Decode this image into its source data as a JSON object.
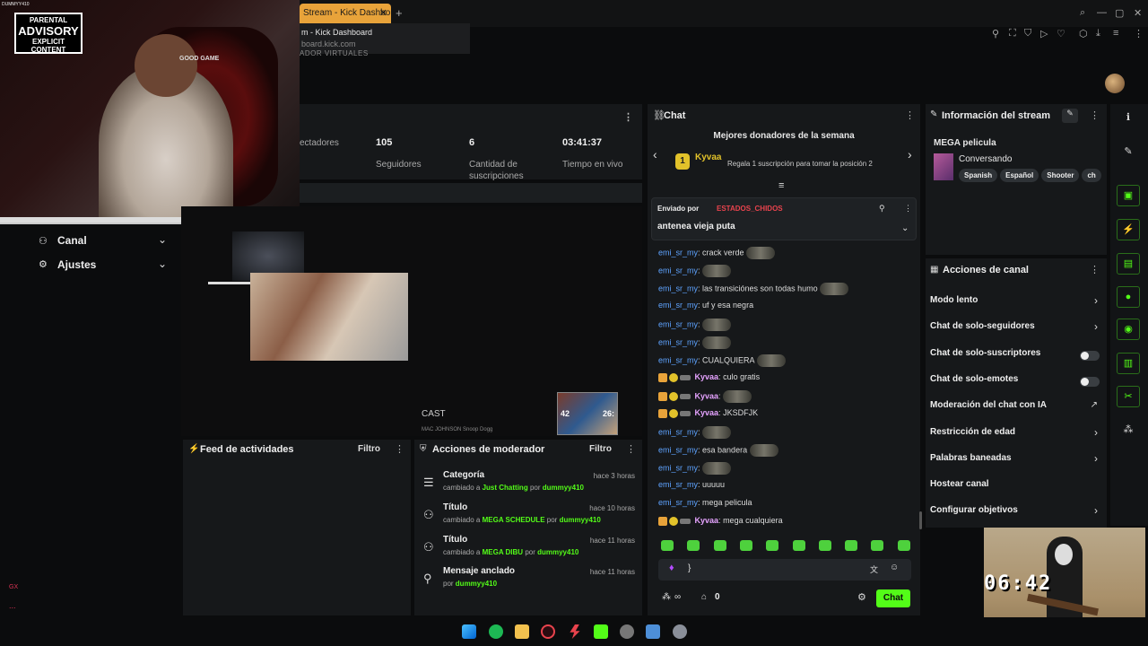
{
  "browser": {
    "tab_title": "Stream - Kick Dashbo",
    "tab_close": "✕",
    "new_tab": "+",
    "tooltip_title": "m - Kick Dashboard",
    "tooltip_url": "board.kick.com",
    "subnav": "ADOR      VIRTUALES"
  },
  "webcam": {
    "label": "DUMMYY410",
    "advisory_top": "PARENTAL",
    "advisory_mid": "ADVISORY",
    "advisory_bot": "EXPLICIT CONTENT",
    "cap_text": "GOOD GAME"
  },
  "sidebar": {
    "items": [
      {
        "label": "Canal",
        "icon": "users-icon"
      },
      {
        "label": "Ajustes",
        "icon": "gear-icon"
      }
    ],
    "gx_label": "GX",
    "more": "..."
  },
  "stats": [
    {
      "value": "",
      "label": "ectadores"
    },
    {
      "value": "105",
      "label": "Seguidores"
    },
    {
      "value": "6",
      "label": "Cantidad de suscripciones"
    },
    {
      "value": "03:41:37",
      "label": "Tiempo en vivo"
    }
  ],
  "video": {
    "cast_title": "CAST",
    "cast_sub": "MAC JOHNSON  Snoop Dogg",
    "thumb_left": "42",
    "thumb_right": "26:"
  },
  "activity": {
    "title": "Feed de actividades",
    "filter": "Filtro"
  },
  "moderator": {
    "title": "Acciones de moderador",
    "filter": "Filtro",
    "rows": [
      {
        "title": "Categoría",
        "pre": "cambiado a",
        "value": "Just Chatting",
        "by": "por",
        "user": "dummyy410",
        "time": "hace 3 horas"
      },
      {
        "title": "Título",
        "pre": "cambiado a",
        "value": "MEGA SCHEDULE",
        "by": "por",
        "user": "dummyy410",
        "time": "hace 10 horas"
      },
      {
        "title": "Título",
        "pre": "cambiado a",
        "value": "MEGA DIBU",
        "by": "por",
        "user": "dummyy410",
        "time": "hace 11 horas"
      },
      {
        "title": "Mensaje anclado",
        "pre": "por",
        "value": "",
        "by": "",
        "user": "dummyy410",
        "time": "hace 11 horas"
      }
    ]
  },
  "chat": {
    "title": "Chat",
    "donors_title": "Mejores donadores de la semana",
    "donor_name": "Kyvaa",
    "donor_rank": "1",
    "gift_prompt": "Regala 1 suscripción para tomar la posición 2",
    "pinned_by": "Enviado por",
    "pinned_user": "ESTADOS_CHIDOS",
    "pinned_msg": "antenea vieja puta",
    "messages": [
      {
        "user": "emi_sr_my",
        "text": "crack verde",
        "emote": true,
        "kick": false
      },
      {
        "user": "emi_sr_my",
        "text": "",
        "emote": true,
        "kick": false
      },
      {
        "user": "emi_sr_my",
        "text": "las transiciónes son todas humo",
        "emote": true,
        "kick": false
      },
      {
        "user": "emi_sr_my",
        "text": "uf y esa negra",
        "emote": false,
        "kick": false
      },
      {
        "user": "emi_sr_my",
        "text": "",
        "emote": true,
        "kick": false
      },
      {
        "user": "emi_sr_my",
        "text": "",
        "emote": true,
        "kick": false
      },
      {
        "user": "emi_sr_my",
        "text": "CUALQUIERA",
        "emote": true,
        "kick": false
      },
      {
        "user": "Kyvaa",
        "text": "culo gratis",
        "emote": false,
        "kick": true
      },
      {
        "user": "Kyvaa",
        "text": "",
        "emote": true,
        "kick": true
      },
      {
        "user": "Kyvaa",
        "text": "JKSDFJK",
        "emote": false,
        "kick": true
      },
      {
        "user": "emi_sr_my",
        "text": "",
        "emote": true,
        "kick": false
      },
      {
        "user": "emi_sr_my",
        "text": "esa bandera",
        "emote": true,
        "kick": false
      },
      {
        "user": "emi_sr_my",
        "text": "",
        "emote": true,
        "kick": false
      },
      {
        "user": "emi_sr_my",
        "text": "uuuuu",
        "emote": false,
        "kick": false
      },
      {
        "user": "emi_sr_my",
        "text": "mega pelicula",
        "emote": false,
        "kick": false
      },
      {
        "user": "Kyvaa",
        "text": "mega cualquiera",
        "emote": false,
        "kick": true
      }
    ],
    "input_value": "}",
    "points": "0",
    "send_label": "Chat",
    "infinity": "∞"
  },
  "stream_info": {
    "title": "Información del stream",
    "stream_title": "MEGA pelicula",
    "category": "Conversando",
    "tags": [
      "Spanish",
      "Español",
      "Shooter",
      "ch"
    ]
  },
  "channel_actions": {
    "title": "Acciones de canal",
    "items": [
      {
        "label": "Modo lento",
        "control": "chevron"
      },
      {
        "label": "Chat de solo-seguidores",
        "control": "chevron"
      },
      {
        "label": "Chat de solo-suscriptores",
        "control": "toggle"
      },
      {
        "label": "Chat de solo-emotes",
        "control": "toggle"
      },
      {
        "label": "Moderación del chat con IA",
        "control": "external"
      },
      {
        "label": "Restricción de edad",
        "control": "chevron"
      },
      {
        "label": "Palabras baneadas",
        "control": "chevron"
      },
      {
        "label": "Hostear canal",
        "control": "none"
      },
      {
        "label": "Configurar objetivos",
        "control": "chevron"
      }
    ]
  },
  "gamecam": {
    "timer": "06:42"
  },
  "colors": {
    "accent": "#53fc18",
    "tab": "#e8a33a",
    "user": "#5ea3ff",
    "kick_user": "#e6a3ff"
  }
}
